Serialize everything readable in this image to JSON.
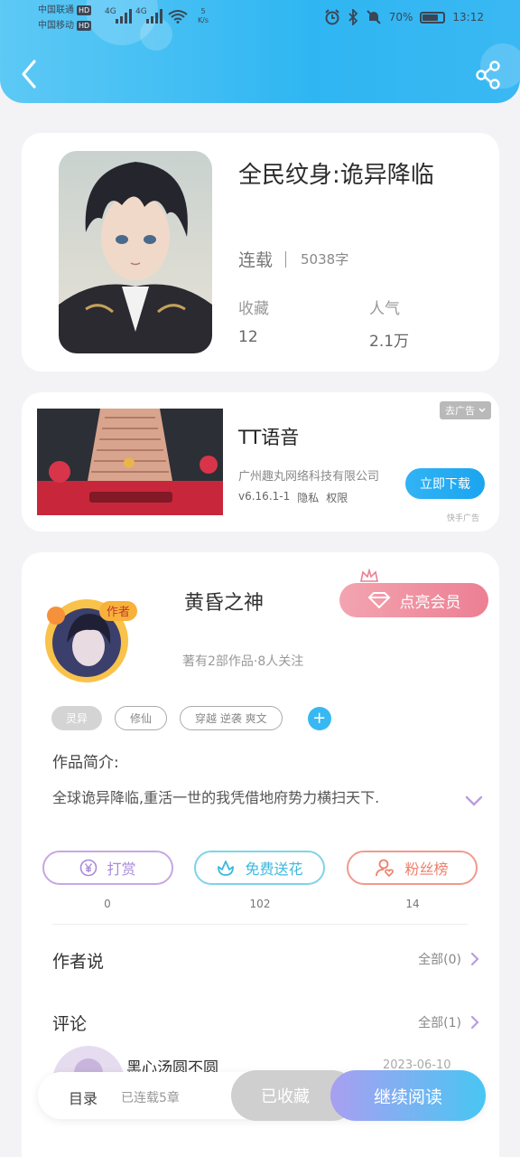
{
  "status_bar": {
    "carrier1": "中国联通",
    "carrier2": "中国移动",
    "hd": "HD",
    "net1": "4G",
    "net2": "4G",
    "speed": "5 K/s",
    "battery": "70%",
    "time": "13:12"
  },
  "book": {
    "title": "全民纹身:诡异降临",
    "status": "连载",
    "word_count": "5038字",
    "favorites_label": "收藏",
    "favorites_value": "12",
    "popularity_label": "人气",
    "popularity_value": "2.1万"
  },
  "ad": {
    "title": "TT语音",
    "company": "广州趣丸网络科技有限公司",
    "version": "v6.16.1-1",
    "privacy": "隐私",
    "permissions": "权限",
    "close_label": "去广告",
    "download_label": "立即下载",
    "source": "快手广告"
  },
  "author": {
    "badge": "作者",
    "name": "黄昏之神",
    "meta": "著有2部作品·8人关注",
    "vip_label": "点亮会员"
  },
  "tags": [
    "灵异",
    "修仙",
    "穿越 逆袭 爽文"
  ],
  "intro": {
    "label": "作品简介:",
    "text": "全球诡异降临,重活一世的我凭借地府势力横扫天下."
  },
  "actions": {
    "reward_label": "打赏",
    "reward_count": "0",
    "flower_label": "免费送花",
    "flower_count": "102",
    "fans_label": "粉丝榜",
    "fans_count": "14"
  },
  "author_says": {
    "label": "作者说",
    "right": "全部(0)"
  },
  "comments": {
    "label": "评论",
    "right": "全部(1)",
    "first_user": "黑心汤圆不圆",
    "first_date": "2023-06-10"
  },
  "bottom_bar": {
    "catalog": "目录",
    "chapters": "已连载5章",
    "collected": "已收藏",
    "continue": "继续阅读"
  },
  "colors": {
    "header": "#2fb6f2",
    "accent_blue": "#38b8f3",
    "vip_pink": "#ec7f93",
    "reward_purple": "#a98bd8",
    "flower_cyan": "#3fb8dd",
    "fans_coral": "#ee7f6c"
  }
}
